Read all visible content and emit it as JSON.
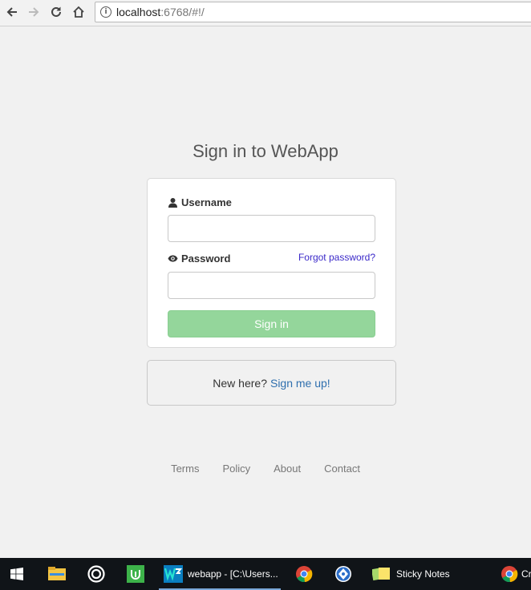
{
  "browser": {
    "url_host": "localhost",
    "url_rest": ":6768/#!/"
  },
  "page": {
    "title": "Sign in to WebApp",
    "username_label": "Username",
    "password_label": "Password",
    "forgot_link": "Forgot password?",
    "username_value": "",
    "password_value": "",
    "signin_button": "Sign in",
    "new_here_text": "New here?",
    "signup_link": "Sign me up!"
  },
  "footer": {
    "links": [
      "Terms",
      "Policy",
      "About",
      "Contact"
    ]
  },
  "taskbar": {
    "items": [
      {
        "icon": "windows-start-icon"
      },
      {
        "icon": "file-explorer-icon"
      },
      {
        "icon": "target-app-icon"
      },
      {
        "icon": "green-app-icon"
      },
      {
        "icon": "webstorm-icon",
        "label": "webapp - [C:\\Users..."
      },
      {
        "icon": "chrome-icon"
      },
      {
        "icon": "network-app-icon"
      },
      {
        "icon": "sticky-notes-icon",
        "label": "Sticky Notes"
      },
      {
        "icon": "chrome-icon",
        "label": "Cr"
      }
    ]
  },
  "colors": {
    "signin_button": "#94d69b",
    "forgot_link": "#3b29c9",
    "signup_link": "#2f6fae",
    "taskbar": "#101418"
  }
}
